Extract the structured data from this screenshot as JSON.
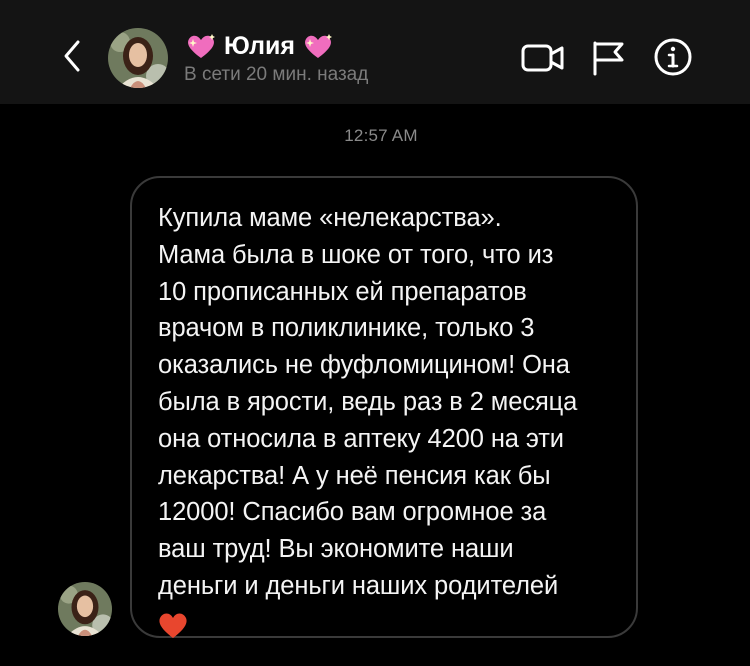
{
  "header": {
    "name": "Юлия",
    "status": "В сети 20 мин. назад",
    "name_decoration_icon": "sparkling-heart-icon",
    "actions": [
      "back-icon",
      "video-call-icon",
      "flag-icon",
      "info-icon"
    ]
  },
  "chat": {
    "timestamp": "12:57 AM",
    "message_lines": [
      "Купила маме «нелекарства».",
      "Мама была в шоке от того, что из",
      "10 прописанных ей препаратов",
      "врачом в поликлинике, только 3",
      "оказались не фуфломицином! Она",
      "была в ярости, ведь раз в 2 месяца",
      "она относила в аптеку 4200 на эти",
      "лекарства! А у неё пенсия как бы",
      "12000! Спасибо вам огромное за",
      "ваш труд! Вы экономите наши",
      "деньги и деньги наших родителей"
    ],
    "message_emoji": "red-heart-icon"
  },
  "colors": {
    "header_bg": "#141414",
    "background": "#000000",
    "bubble_border": "#3a3a3a",
    "status_text": "#7b7b7b",
    "heart": "#e8462e",
    "pink_heart": "#f06dbe"
  }
}
